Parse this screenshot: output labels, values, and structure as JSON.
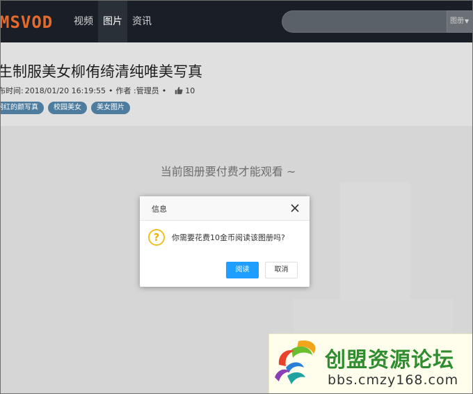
{
  "header": {
    "logo": "MSVOD",
    "nav": [
      "视频",
      "图片",
      "资讯"
    ],
    "active_nav": 1,
    "search": {
      "placeholder": "",
      "select_value": "图册"
    }
  },
  "article": {
    "title": "生制服美女柳侑绮清纯唯美写真",
    "meta": {
      "time_label": "布时间:",
      "time_value": "2018/01/20 16:19:55",
      "author_label": "作者 :",
      "author_value": "管理员",
      "likes": "10"
    },
    "tags": [
      "网红的颜写真",
      "校园美女",
      "美女图片"
    ]
  },
  "content": {
    "paywall_text": "当前图册要付费才能观看 ~"
  },
  "dialog": {
    "title": "信息",
    "message": "你需要花费10金币阅读该图册吗?",
    "confirm_label": "阅读",
    "cancel_label": "取消",
    "icon_glyph": "?"
  },
  "watermark": {
    "name": "创盟资源论坛",
    "url": "bbs.cmzy168.com"
  },
  "colors": {
    "header_bg": "#1a1f27",
    "logo": "#e56a2c",
    "primary_button": "#1e9fff",
    "tag_bg": "#4e7c9e",
    "watermark_green": "#2f8d2f"
  }
}
